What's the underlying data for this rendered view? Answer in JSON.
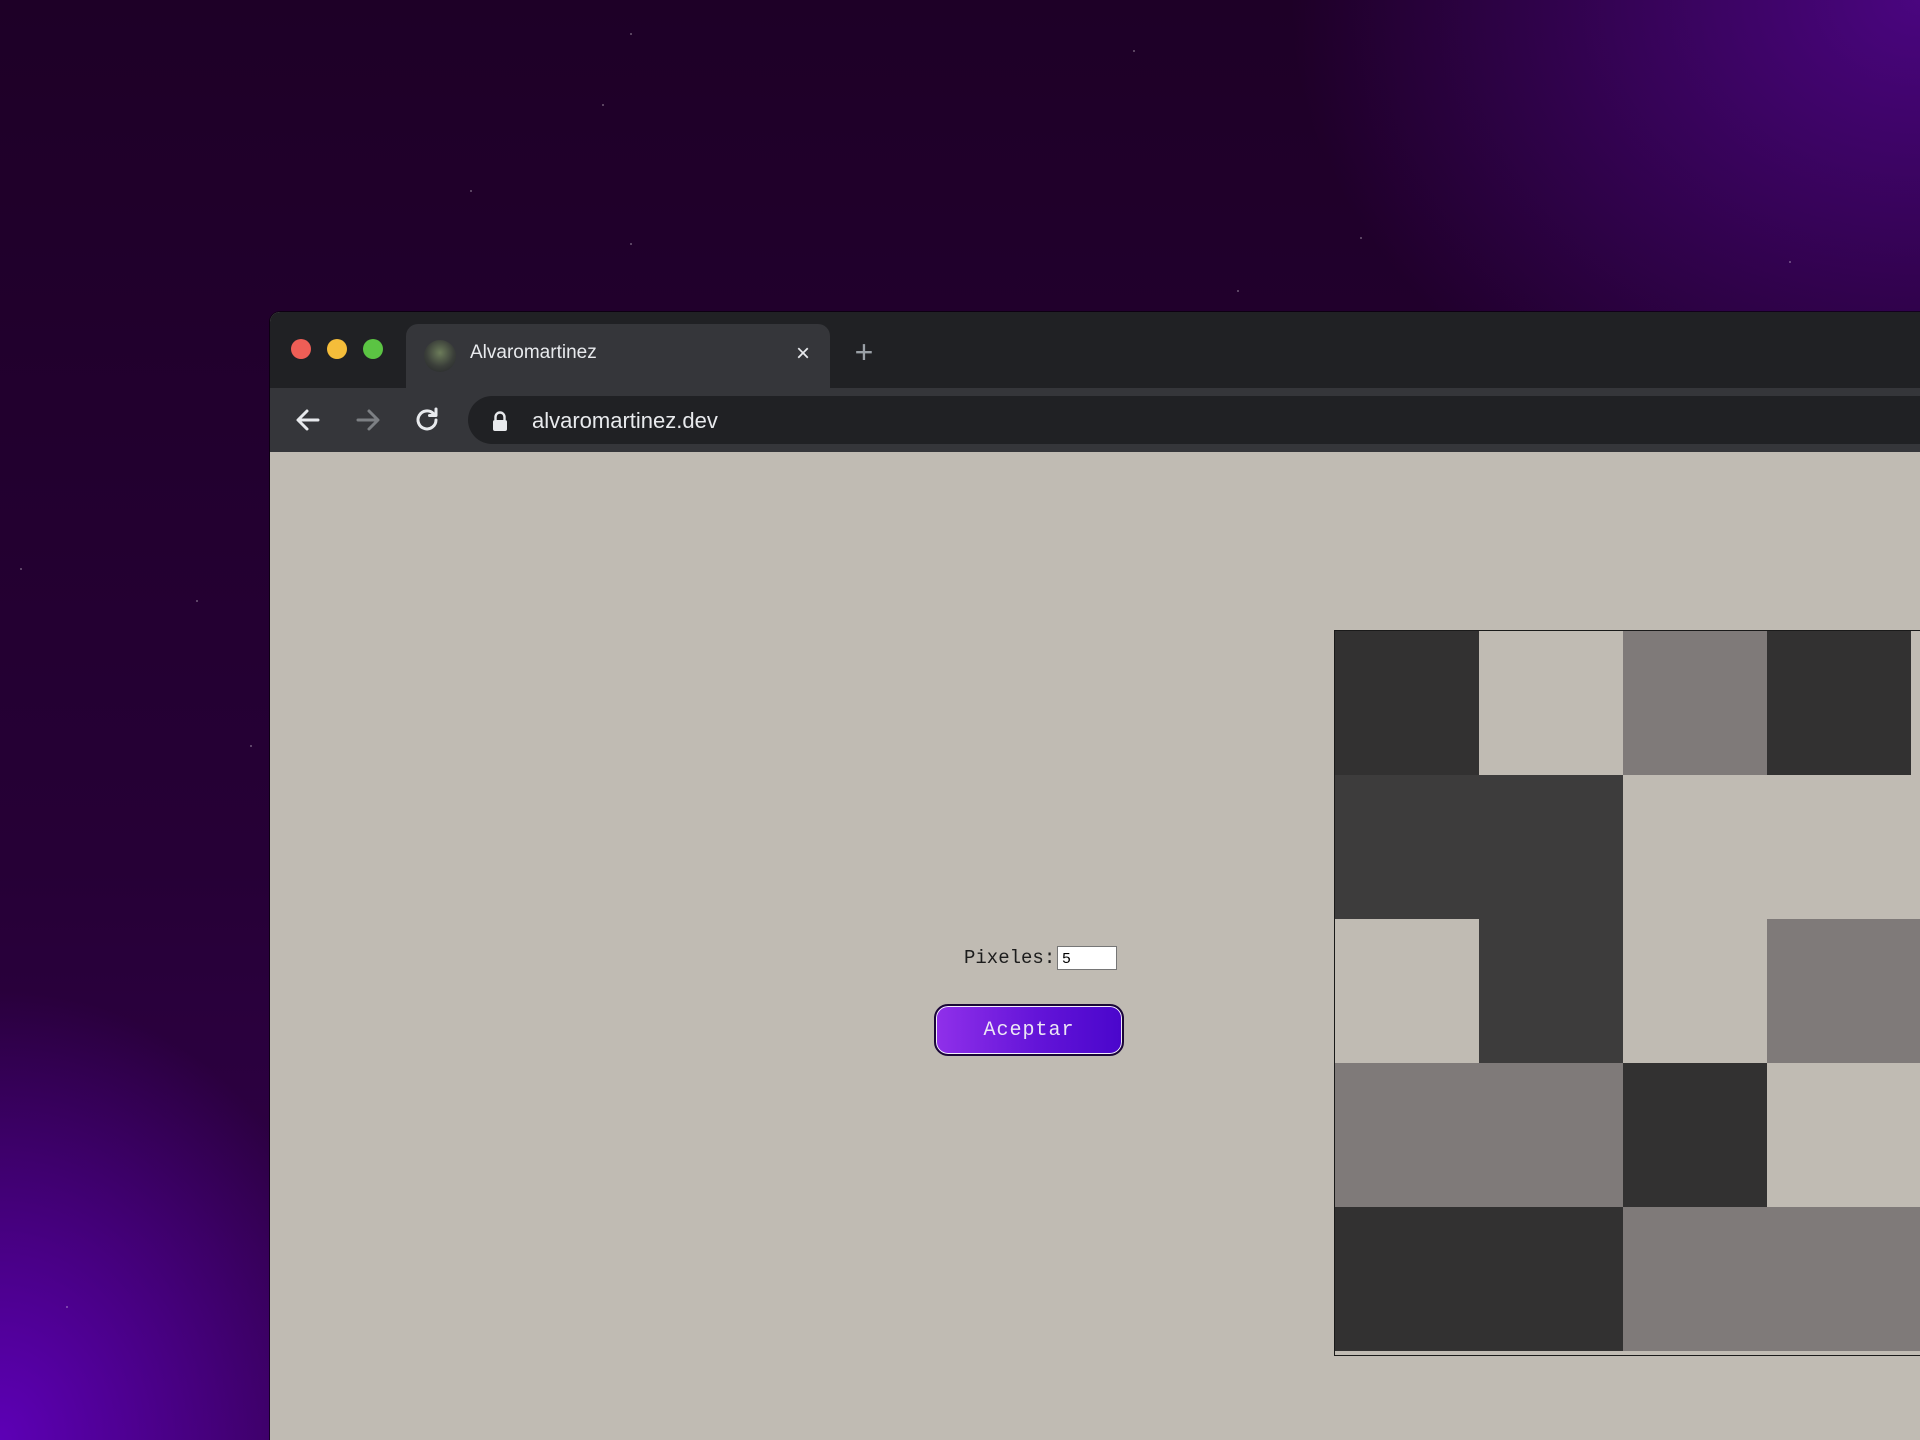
{
  "browser": {
    "tab": {
      "title": "Alvaromartinez",
      "favicon": "avatar-icon",
      "close": "×"
    },
    "new_tab": "+",
    "nav": {
      "back": "back-arrow-icon",
      "forward": "forward-arrow-icon",
      "reload": "reload-icon"
    },
    "address": {
      "lock": "lock-icon",
      "url": "alvaromartinez.dev"
    }
  },
  "page": {
    "pixels_label": "Pixeles:",
    "pixels_value": "5",
    "accept_label": "Aceptar",
    "grid": {
      "size": 5,
      "colors": {
        "dark": "#323131",
        "mid": "#3d3c3c",
        "gray": "#7f7a79",
        "light": "#c0bbb3"
      },
      "cells": [
        [
          "dark",
          "light",
          "gray",
          "dark",
          "light"
        ],
        [
          "mid",
          "mid",
          "light",
          "light",
          "light"
        ],
        [
          "light",
          "mid",
          "light",
          "gray",
          "gray"
        ],
        [
          "gray",
          "gray",
          "dark",
          "light",
          "light"
        ],
        [
          "dark",
          "dark",
          "gray",
          "gray",
          "gray"
        ]
      ]
    }
  }
}
